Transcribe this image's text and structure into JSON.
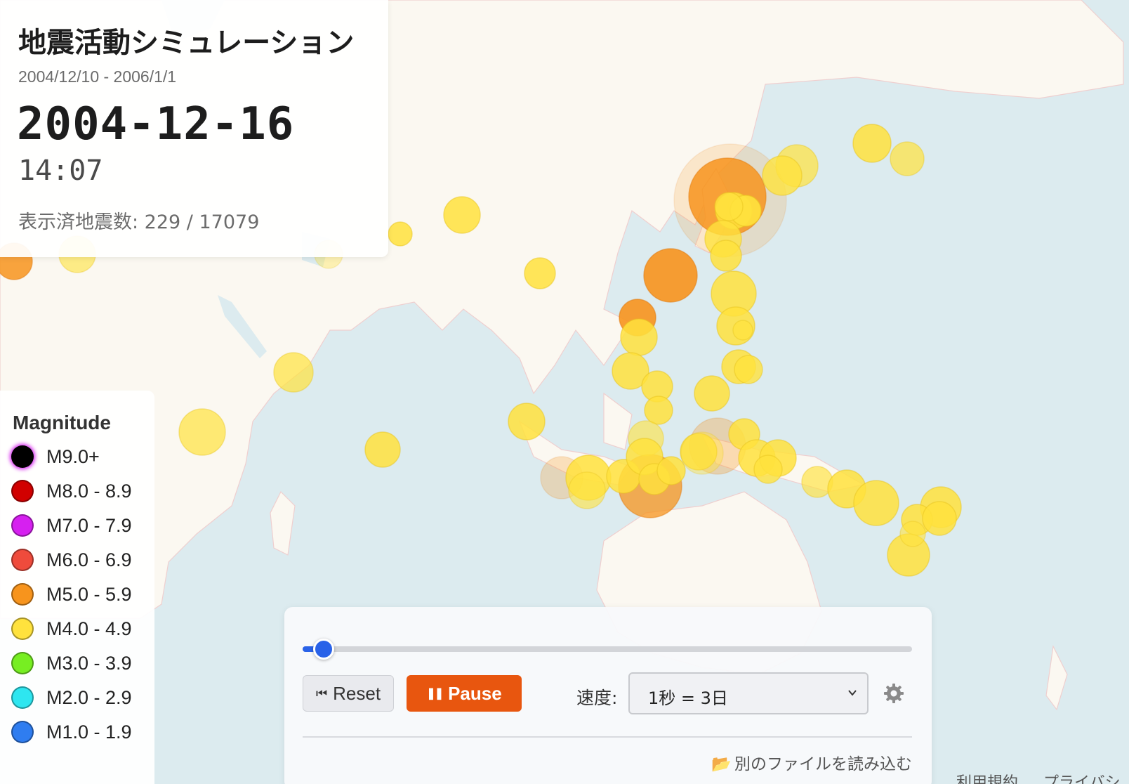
{
  "header": {
    "title": "地震活動シミュレーション",
    "date_range": "2004/12/10 - 2006/1/1",
    "current_date": "2004-12-16",
    "current_time": "14:07",
    "count_text": "表示済地震数: 229 / 17079"
  },
  "legend": {
    "title": "Magnitude",
    "items": [
      {
        "label": "M9.0+",
        "color": "#000000"
      },
      {
        "label": "M8.0 - 8.9",
        "color": "#d10000"
      },
      {
        "label": "M7.0 - 7.9",
        "color": "#d620f0"
      },
      {
        "label": "M6.0 - 6.9",
        "color": "#ef4b3c"
      },
      {
        "label": "M5.0 - 5.9",
        "color": "#f7941d"
      },
      {
        "label": "M4.0 - 4.9",
        "color": "#ffe23d"
      },
      {
        "label": "M3.0 - 3.9",
        "color": "#77ee22"
      },
      {
        "label": "M2.0 - 2.9",
        "color": "#2ee6f0"
      },
      {
        "label": "M1.0 - 1.9",
        "color": "#2f7df0"
      }
    ]
  },
  "controls": {
    "progress": 0.035,
    "reset_label": "Reset",
    "pause_label": "Pause",
    "speed_label": "速度:",
    "speed_value": "1秒 = 3日",
    "load_file_label": "別のファイルを読み込む"
  },
  "footer": {
    "terms": "利用規約",
    "privacy": "プライバシ"
  },
  "colors": {
    "m4": "#ffe23d",
    "m5": "#f7941d",
    "accent": "#2962e8",
    "pause": "#e8560f"
  },
  "icons": {
    "reset": "skip-back-icon",
    "pause": "pause-icon",
    "settings": "gear-icon",
    "folder": "folder-icon",
    "chevron": "chevron-down-icon"
  }
}
